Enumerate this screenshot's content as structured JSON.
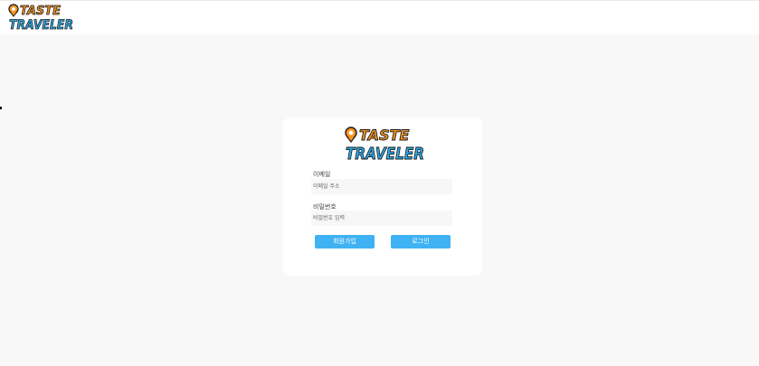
{
  "header": {
    "logo": {
      "line1": "TASTE",
      "line2": "TRAVELER"
    }
  },
  "login": {
    "logo": {
      "line1": "TASTE",
      "line2": "TRAVELER"
    },
    "email_label": "이메일",
    "email_placeholder": "이메일 주소",
    "password_label": "비밀번호",
    "password_placeholder": "비밀번호 입력",
    "signup_label": "회원가입",
    "login_label": "로그인"
  },
  "colors": {
    "brand_orange": "#f7941d",
    "brand_blue": "#2aa7e8",
    "button": "#3fb2f4",
    "background": "#f8f8f8"
  }
}
